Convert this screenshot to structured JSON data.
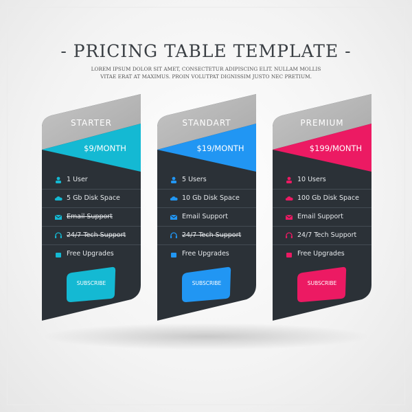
{
  "header": {
    "title": "- PRICING TABLE TEMPLATE -",
    "subtitle_line1": "LOREM IPSUM DOLOR SIT AMET, CONSECTETUR ADIPISCING ELIT. NULLAM MOLLIS",
    "subtitle_line2": "VITAE ERAT AT MAXIMUS. PROIN VOLUTPAT DIGNISSIM JUSTO NEC PRETIUM."
  },
  "colors": {
    "dark": "#2b3137",
    "gray": "#b8b8b8"
  },
  "plans": [
    {
      "name": "STARTER",
      "price": "$9/MONTH",
      "accent": "#14b9d3",
      "button": "SUBSCRIBE",
      "features": [
        {
          "icon": "user-icon",
          "text": "1 User",
          "included": true
        },
        {
          "icon": "cloud-icon",
          "text": "5 Gb Disk Space",
          "included": true
        },
        {
          "icon": "envelope-icon",
          "text": "Email Support",
          "included": false
        },
        {
          "icon": "headset-icon",
          "text": "24/7 Tech Support",
          "included": false
        },
        {
          "icon": "gift-icon",
          "text": "Free Upgrades",
          "included": true
        }
      ]
    },
    {
      "name": "STANDART",
      "price": "$19/MONTH",
      "accent": "#2196f3",
      "button": "SUBSCRIBE",
      "features": [
        {
          "icon": "user-icon",
          "text": "5 Users",
          "included": true
        },
        {
          "icon": "cloud-icon",
          "text": "10 Gb Disk Space",
          "included": true
        },
        {
          "icon": "envelope-icon",
          "text": "Email Support",
          "included": true
        },
        {
          "icon": "headset-icon",
          "text": "24/7 Tech Support",
          "included": false
        },
        {
          "icon": "gift-icon",
          "text": "Free Upgrades",
          "included": true
        }
      ]
    },
    {
      "name": "PREMIUM",
      "price": "$199/MONTH",
      "accent": "#ec1a63",
      "button": "SUBSCRIBE",
      "features": [
        {
          "icon": "user-icon",
          "text": "10 Users",
          "included": true
        },
        {
          "icon": "cloud-icon",
          "text": "100 Gb Disk Space",
          "included": true
        },
        {
          "icon": "envelope-icon",
          "text": "Email Support",
          "included": true
        },
        {
          "icon": "headset-icon",
          "text": "24/7 Tech Support",
          "included": true
        },
        {
          "icon": "gift-icon",
          "text": "Free Upgrades",
          "included": true
        }
      ]
    }
  ]
}
